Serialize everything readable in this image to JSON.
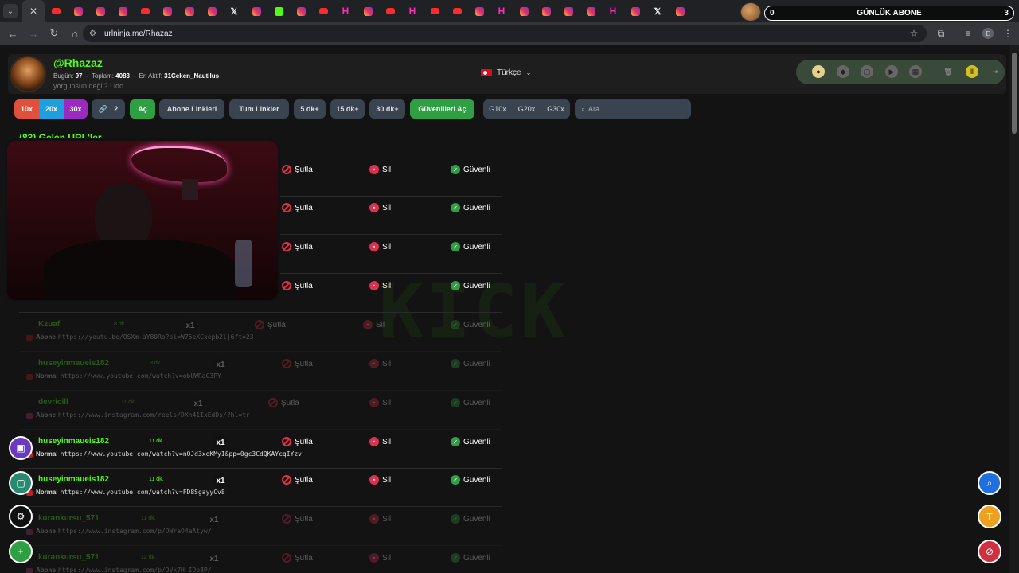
{
  "browser": {
    "url": "urlninja.me/Rhazaz",
    "tabs": [
      "yt",
      "ig",
      "ig",
      "ig",
      "yt",
      "ig",
      "ig",
      "ig",
      "x",
      "ig",
      "kk",
      "ig",
      "yt",
      "hs",
      "ig",
      "yt",
      "hs",
      "yt",
      "yt",
      "ig",
      "hs",
      "ig",
      "ig",
      "ig",
      "ig",
      "hs",
      "ig",
      "x",
      "ig"
    ],
    "tab_glyphs": {
      "x": "𝕏",
      "hs": "H"
    }
  },
  "overlay": {
    "sub_goal_left": "0",
    "sub_goal_label": "GÜNLÜK ABONE",
    "sub_goal_right": "3"
  },
  "header": {
    "username": "@Rhazaz",
    "stats": {
      "today_label": "Bugün:",
      "today_value": "97",
      "total_label": "Toplam:",
      "total_value": "4083",
      "active_label": "En Aktif:",
      "active_value": "31Ceken_Nautilus"
    },
    "tagline": "yorgunsun değil? ! idc",
    "language": "Türkçe"
  },
  "filters": {
    "mult": [
      "10x",
      "20x",
      "30x"
    ],
    "link_count": "2",
    "open": "Aç",
    "sub_links": "Abone Linkleri",
    "all_links": "Tum Linkler",
    "m5": "5 dk+",
    "m15": "15 dk+",
    "m30": "30 dk+",
    "open_safe": "Güvenlileri Aç",
    "g10": "G10x",
    "g20": "G20x",
    "g30": "G30x",
    "search_placeholder": "Ara..."
  },
  "list": {
    "title": "(83) Gelen URL'ler",
    "actions": {
      "skip": "Şutla",
      "delete": "Sil",
      "safe": "Güvenli"
    },
    "rows": [
      {
        "name": "",
        "time": "",
        "count": "",
        "type": "",
        "url": "",
        "icon": "",
        "dim": false
      },
      {
        "name": "",
        "time": "",
        "count": "",
        "type": "",
        "url": "",
        "icon": "",
        "dim": false
      },
      {
        "name": "",
        "time": "",
        "count": "",
        "type": "",
        "url": "",
        "icon": "",
        "dim": false
      },
      {
        "name": "",
        "time": "",
        "count": "",
        "type": "",
        "url": "",
        "icon": "",
        "dim": false
      },
      {
        "name": "Kzuaf",
        "time": "8 dk.",
        "count": "x1",
        "type": "Abone",
        "url": "https://youtu.be/OSXm-aY80Ro?si=W75eXCxepb2lj6ft=23",
        "icon": "yt",
        "dim": true
      },
      {
        "name": "huseyinmaueis182",
        "time": "9 dk.",
        "count": "x1",
        "type": "Normal",
        "url": "https://www.youtube.com/watch?v=obUWRaC3PY",
        "icon": "yt",
        "dim": true
      },
      {
        "name": "devricill",
        "time": "11 dk.",
        "count": "x1",
        "type": "Abone",
        "url": "https://www.instagram.com/reels/DXn41IxEdDs/?hl=tr",
        "icon": "ig",
        "dim": true
      },
      {
        "name": "huseyinmaueis182",
        "time": "11 dk.",
        "count": "x1",
        "type": "Normal",
        "url": "https://www.youtube.com/watch?v=nOJd3xoKMyI&pp=0gc3CdQKAYcqIYzv",
        "icon": "yt",
        "dim": false
      },
      {
        "name": "huseyinmaueis182",
        "time": "11 dk.",
        "count": "x1",
        "type": "Normal",
        "url": "https://www.youtube.com/watch?v=FD8SgayyCv8",
        "icon": "yt",
        "dim": false
      },
      {
        "name": "kurankursu_571",
        "time": "11 dk.",
        "count": "x1",
        "type": "Abone",
        "url": "https://www.instagram.com/p/DWraO4aAtyw/",
        "icon": "ig",
        "dim": true
      },
      {
        "name": "kurankursu_571",
        "time": "12 dk.",
        "count": "x1",
        "type": "Abone",
        "url": "https://www.instagram.com/p/DVk7H_IDb8P/",
        "icon": "ig",
        "dim": true
      }
    ]
  },
  "colors": {
    "accent": "#53fc18",
    "danger": "#e03050",
    "safe": "#2ea043"
  }
}
